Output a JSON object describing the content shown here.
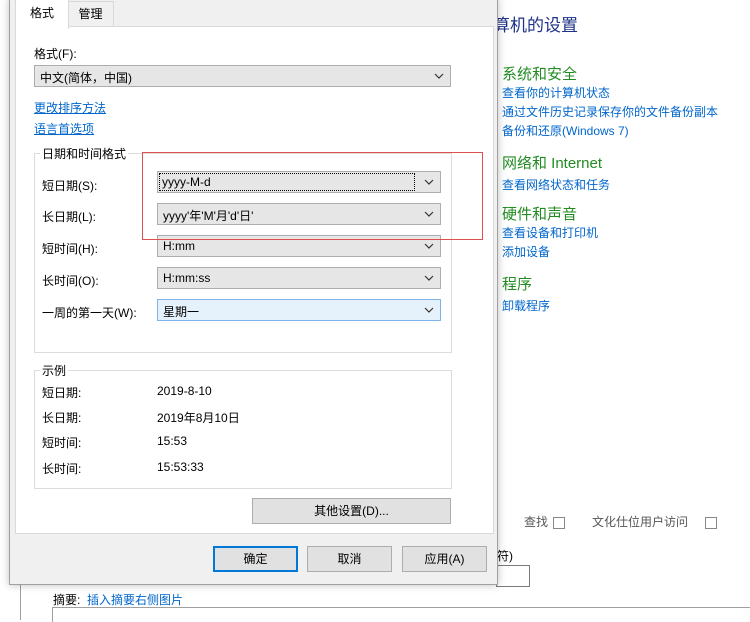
{
  "background": {
    "control_panel_title": "算机的设置",
    "categories": [
      {
        "title": "系统和安全",
        "links": [
          "查看你的计算机状态",
          "通过文件历史记录保存你的文件备份副本",
          "备份和还原(Windows 7)"
        ]
      },
      {
        "title": "网络和 Internet",
        "links": [
          "查看网络状态和任务"
        ]
      },
      {
        "title": "硬件和声音",
        "links": [
          "查看设备和打印机",
          "添加设备"
        ]
      },
      {
        "title": "程序",
        "links": [
          "卸载程序"
        ]
      }
    ],
    "strip_text_1": "查找",
    "strip_text_2": "文化仕位用户访问",
    "fragment_label": "符)",
    "summary_label": "摘要:",
    "summary_link": "插入摘要右侧图片"
  },
  "dialog": {
    "tabs": [
      "格式",
      "管理"
    ],
    "format_label": "格式(F):",
    "format_value": "中文(简体，中国)",
    "link_sort": "更改排序方法",
    "link_language": "语言首选项",
    "datetime_group_title": "日期和时间格式",
    "fields": [
      {
        "label": "短日期(S):",
        "value": "yyyy-M-d"
      },
      {
        "label": "长日期(L):",
        "value": "yyyy'年'M'月'd'日'"
      },
      {
        "label": "短时间(H):",
        "value": "H:mm"
      },
      {
        "label": "长时间(O):",
        "value": "H:mm:ss"
      },
      {
        "label": "一周的第一天(W):",
        "value": "星期一"
      }
    ],
    "examples_group_title": "示例",
    "examples": [
      {
        "label": "短日期:",
        "value": "2019-8-10"
      },
      {
        "label": "长日期:",
        "value": "2019年8月10日"
      },
      {
        "label": "短时间:",
        "value": "15:53"
      },
      {
        "label": "长时间:",
        "value": "15:53:33"
      }
    ],
    "other_settings_button": "其他设置(D)...",
    "ok_button": "确定",
    "cancel_button": "取消",
    "apply_button": "应用(A)"
  },
  "colors": {
    "link": "#0066cc",
    "category_green": "#228b22",
    "title_blue": "#1e3287",
    "highlight_red": "#e05050",
    "default_button_border": "#0078d7"
  }
}
